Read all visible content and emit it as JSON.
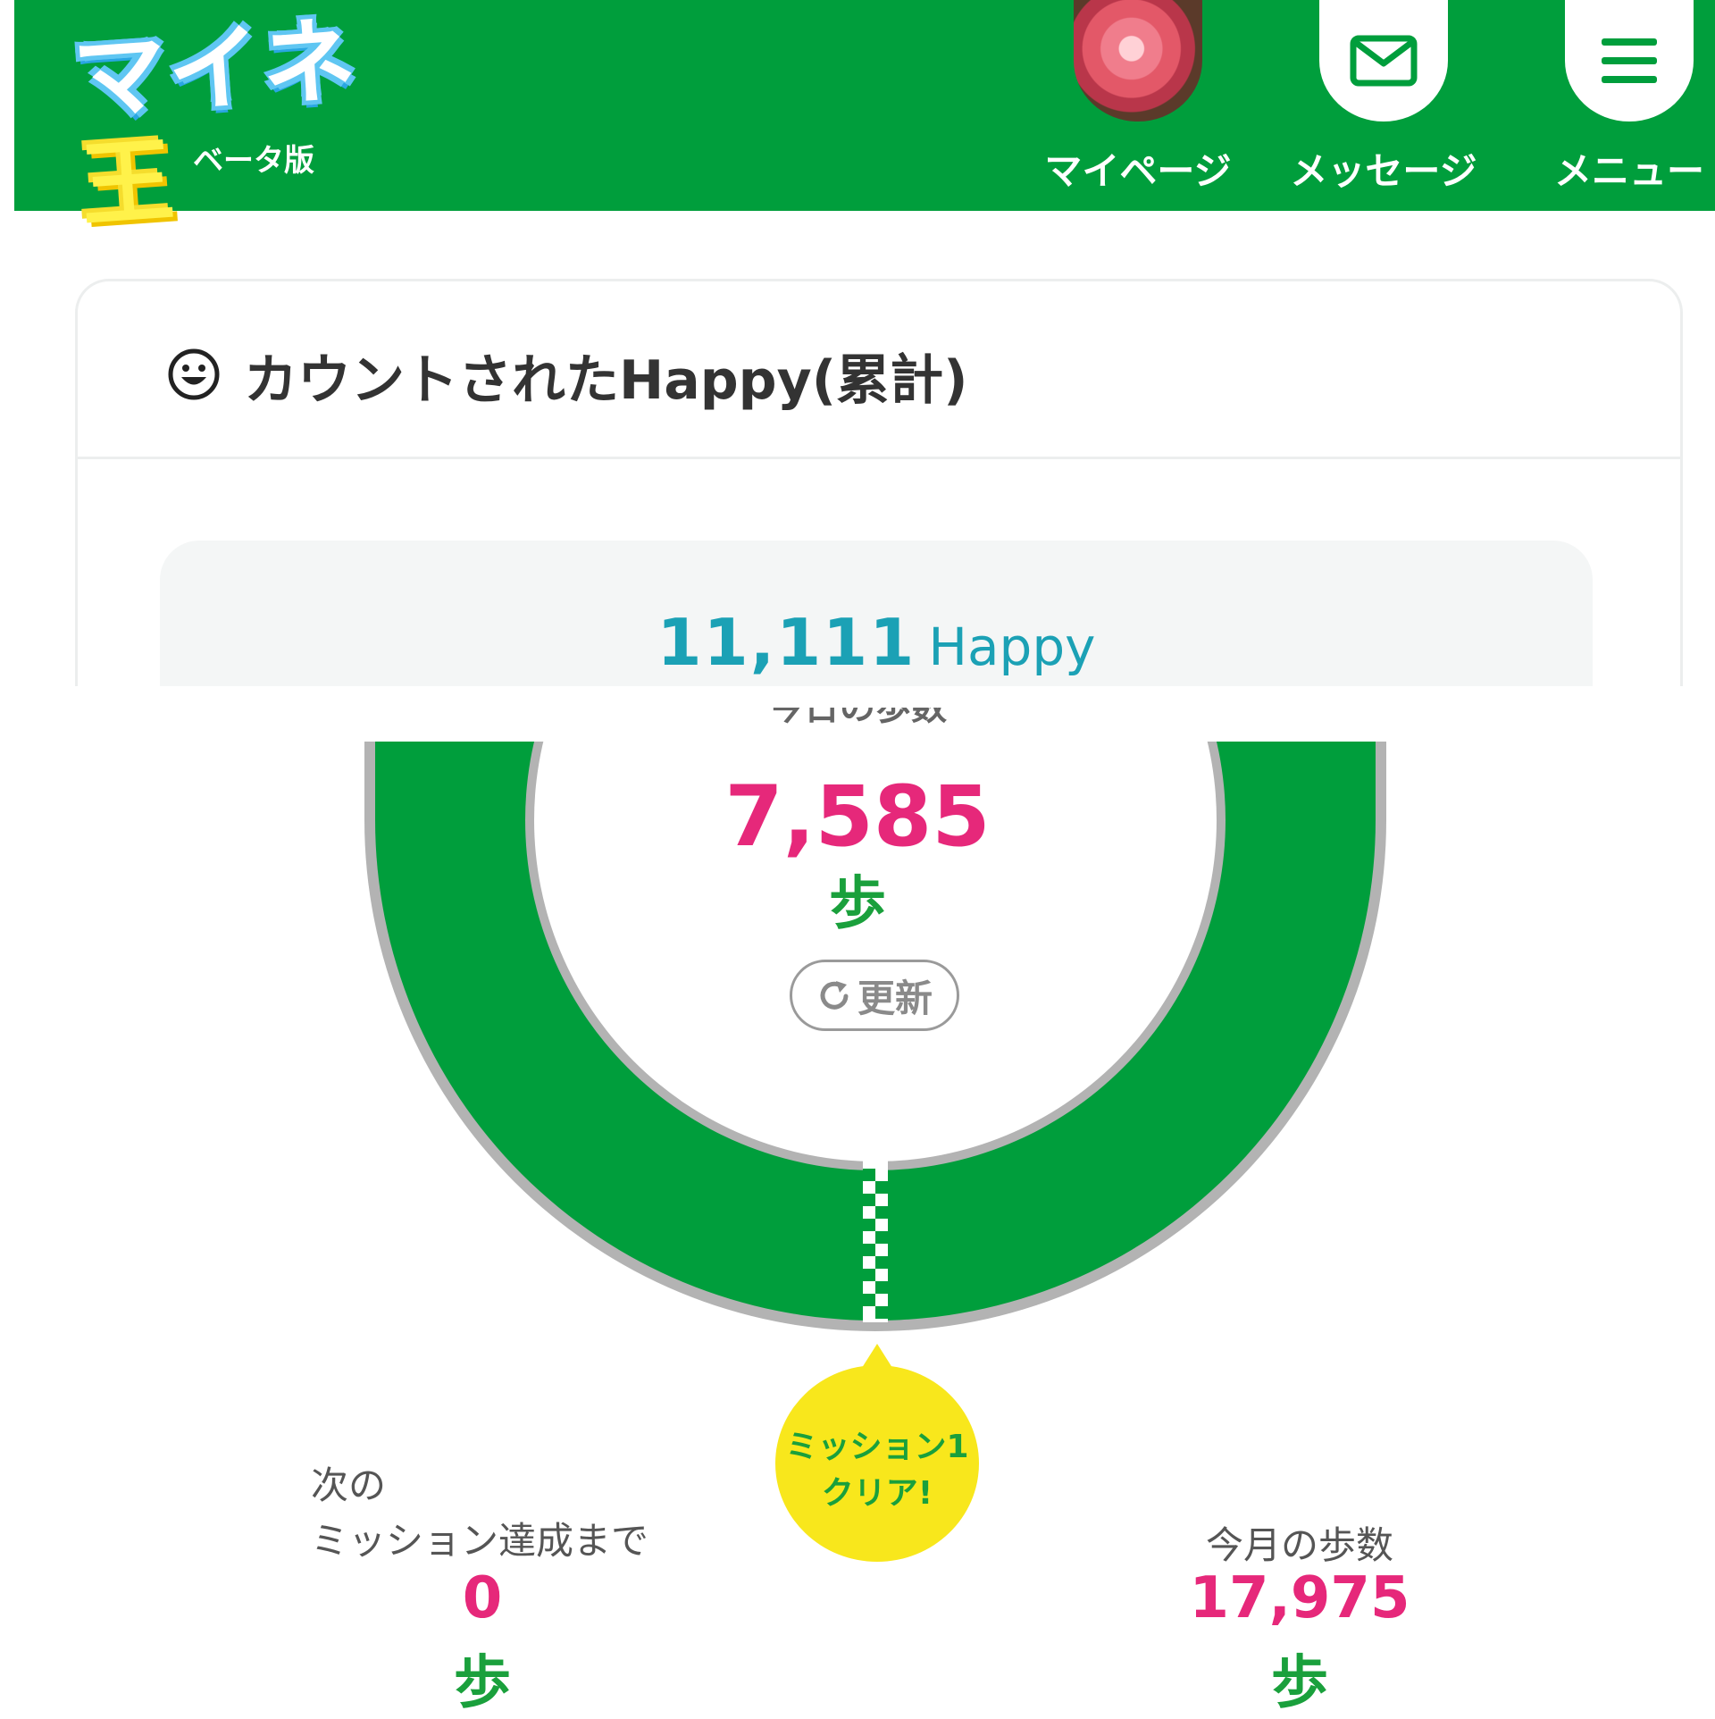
{
  "header": {
    "logo_text_main": "マイネ",
    "logo_text_accent": "王",
    "logo_sub": "ベータ版",
    "nav": {
      "mypage_label": "マイページ",
      "message_label": "メッセージ",
      "menu_label": "メニュー"
    }
  },
  "card": {
    "title": "カウントされたHappy(累計)",
    "total_value": "11,111",
    "total_unit": "Happy"
  },
  "steps": {
    "today_label": "今日の歩数",
    "today_value": "7,585",
    "today_unit": "歩",
    "refresh_label": "更新",
    "mission_badge_line1": "ミッション1",
    "mission_badge_line2": "クリア!",
    "next_label_line1": "次の",
    "next_label_line2": "ミッション達成まで",
    "next_value": "0",
    "next_unit": "歩",
    "month_label": "今月の歩数",
    "month_value": "17,975",
    "month_unit": "歩",
    "progress_fraction": 1.0
  },
  "colors": {
    "header_bg": "#009e3c",
    "ring_green": "#009e3c",
    "ring_gray": "#b3b3b3",
    "accent_pink": "#e6287a",
    "accent_teal": "#1ba1b5",
    "badge_yellow": "#f8e71c"
  },
  "icons": {
    "avatar": "avatar-carnation-photo",
    "message": "envelope-icon",
    "menu": "hamburger-icon",
    "title": "smile-icon",
    "refresh": "refresh-icon"
  }
}
